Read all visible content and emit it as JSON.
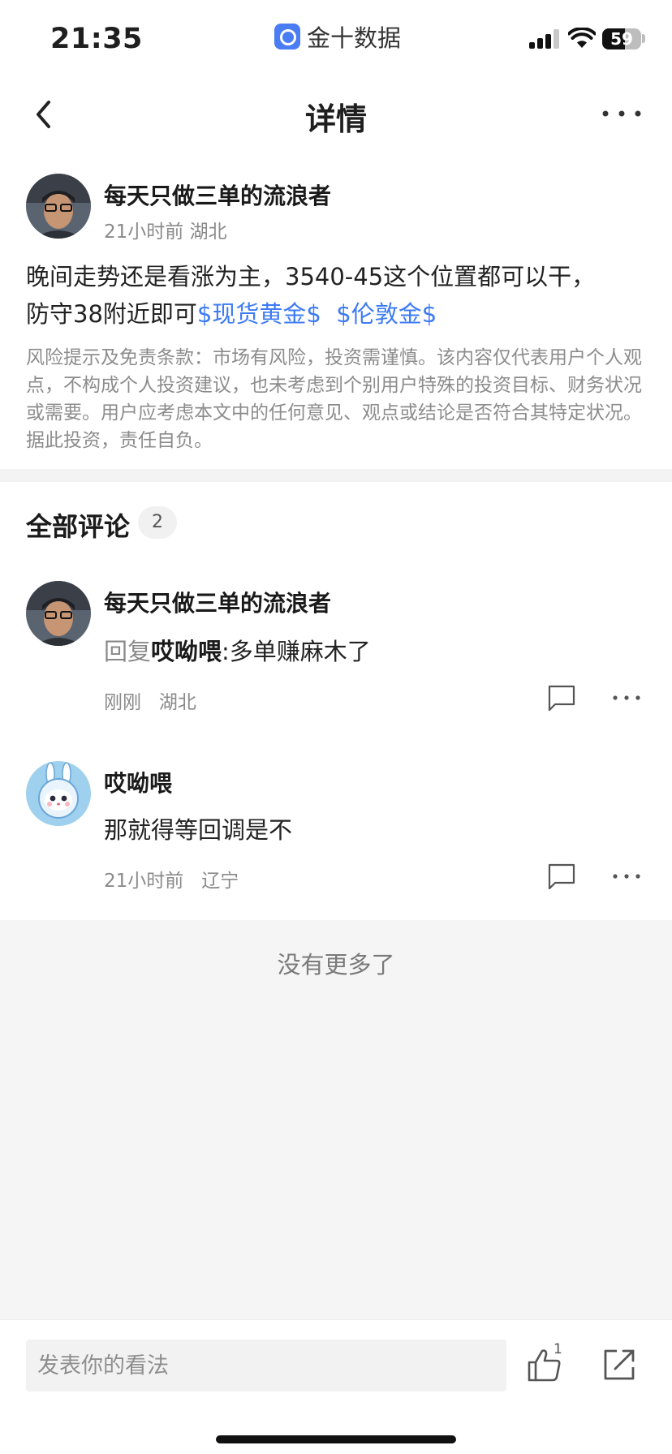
{
  "status_bar": {
    "time": "21:35",
    "app_name": "金十数据",
    "battery_level": "59"
  },
  "header": {
    "title": "详情"
  },
  "post": {
    "author": "每天只做三单的流浪者",
    "meta": "21小时前 湖北",
    "text_line1": "晚间走势还是看涨为主，3540-45这个位置都可以干，",
    "text_line2": "防守38附近即可",
    "tag1": "$现货黄金$",
    "tag2": "$伦敦金$",
    "disclaimer": "风险提示及免责条款：市场有风险，投资需谨慎。该内容仅代表用户个人观点，不构成个人投资建议，也未考虑到个别用户特殊的投资目标、财务状况或需要。用户应考虑本文中的任何意见、观点或结论是否符合其特定状况。据此投资，责任自负。"
  },
  "comments_section": {
    "title": "全部评论",
    "count": "2",
    "comments": [
      {
        "author": "每天只做三单的流浪者",
        "reply_prefix": "回复",
        "reply_target": "哎呦喂",
        "text": ":多单赚麻木了",
        "meta": "刚刚   湖北"
      },
      {
        "author": "哎呦喂",
        "text": "那就得等回调是不",
        "meta": "21小时前   辽宁"
      }
    ],
    "end_text": "没有更多了"
  },
  "bottom_bar": {
    "input_placeholder": "发表你的看法",
    "like_count": "1"
  },
  "colors": {
    "accent": "#3d7bf3",
    "app_icon": "#4a7cf3"
  }
}
